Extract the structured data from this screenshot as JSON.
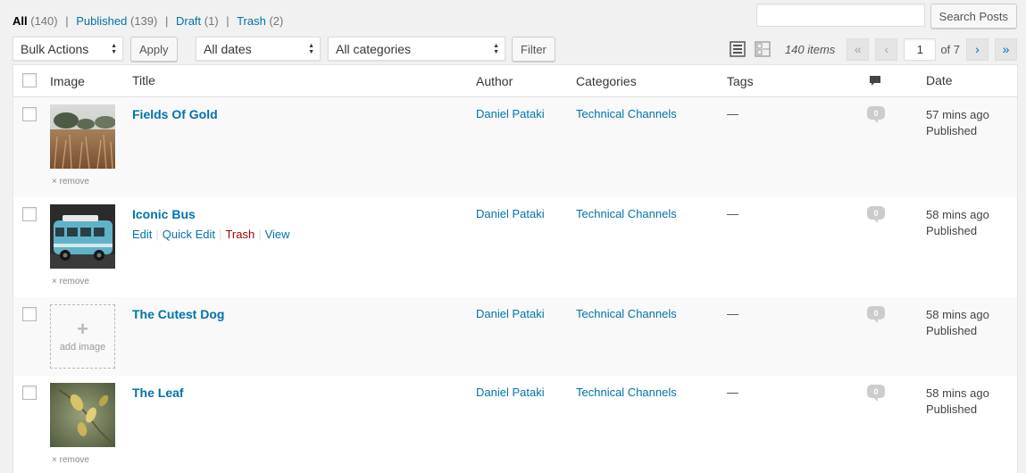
{
  "status_filters": [
    {
      "label": "All",
      "count": "(140)"
    },
    {
      "label": "Published",
      "count": "(139)"
    },
    {
      "label": "Draft",
      "count": "(1)"
    },
    {
      "label": "Trash",
      "count": "(2)"
    }
  ],
  "search": {
    "value": "",
    "button_label": "Search Posts"
  },
  "tablenav": {
    "bulk_actions": "Bulk Actions",
    "apply_label": "Apply",
    "dates": "All dates",
    "categories": "All categories",
    "filter_label": "Filter",
    "items_count": "140 items",
    "first_page": "«",
    "prev_page": "‹",
    "current_page": "1",
    "of_pages": "of 7",
    "next_page": "›",
    "last_page": "»"
  },
  "columns": {
    "image": "Image",
    "title": "Title",
    "author": "Author",
    "categories": "Categories",
    "tags": "Tags",
    "date": "Date"
  },
  "remove_label": "remove",
  "add_image_label": "add image",
  "row_action_labels": {
    "edit": "Edit",
    "quick_edit": "Quick Edit",
    "trash": "Trash",
    "view": "View"
  },
  "posts": [
    {
      "title": "Fields Of Gold",
      "author": "Daniel Pataki",
      "category": "Technical Channels",
      "tags": "—",
      "comments": "0",
      "date": "57 mins ago",
      "status": "Published",
      "image": "field"
    },
    {
      "title": "Iconic Bus",
      "author": "Daniel Pataki",
      "category": "Technical Channels",
      "tags": "—",
      "comments": "0",
      "date": "58 mins ago",
      "status": "Published",
      "image": "bus"
    },
    {
      "title": "The Cutest Dog",
      "author": "Daniel Pataki",
      "category": "Technical Channels",
      "tags": "—",
      "comments": "0",
      "date": "58 mins ago",
      "status": "Published",
      "image": "none"
    },
    {
      "title": "The Leaf",
      "author": "Daniel Pataki",
      "category": "Technical Channels",
      "tags": "—",
      "comments": "0",
      "date": "58 mins ago",
      "status": "Published",
      "image": "leaf"
    }
  ]
}
